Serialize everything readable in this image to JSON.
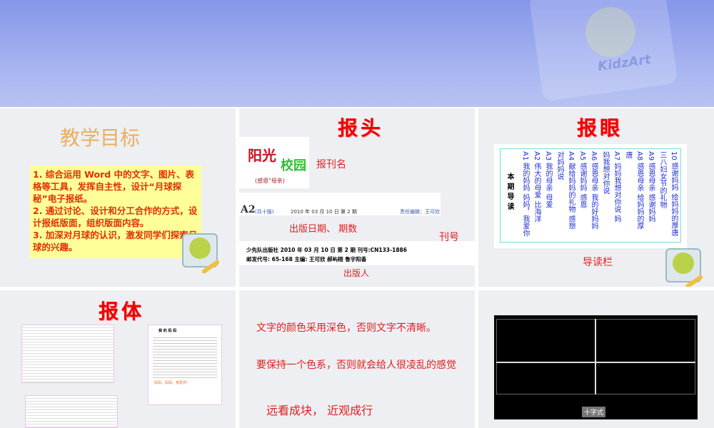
{
  "banner": {
    "brand": "KidzArt"
  },
  "slides": [
    {
      "title": "教学目标",
      "items": [
        "1. 综合运用 Word 中的文字、图片、表格等工具，发挥自主性，设计“月球探秘”电子报纸。",
        "2. 通过讨论、设计和分工合作的方式，设计报纸版面，组织版面内容。",
        "3. 加深对月球的认识，激发同学们探索月球的兴趣。"
      ]
    },
    {
      "title": "报头",
      "masthead_a": "阳光",
      "masthead_b": "校园",
      "masthead_sub": "(感恩\"母亲)",
      "label_name": "报刊名",
      "header_line": {
        "page": "A2",
        "pages": "(共十版)",
        "date": "2010 年 03 月 10 日  第 2 期",
        "editor": "责任编辑：王可欣"
      },
      "label_date": "出版日期、 期数",
      "label_issue": "刊号",
      "footer_line1": "少先队出版社   2010 年 03 月 10 日   第 2 期   刊号:CN133-1886",
      "footer_line2": "邮发代号: 65-168   主编: 王可欣 郝屿栩 鲁宇阳香",
      "label_publisher": "出版人"
    },
    {
      "title": "报眼",
      "columns": [
        "10 感谢妈妈 给妈妈的厚唐",
        "三八妇女节的礼物",
        "A9 感恩母亲 感谢妈妈",
        "A8 感恩母亲 给妈妈的厚",
        "唐",
        "A7 妈妈我想对你说 妈",
        "妈我想对你说",
        "A6 感恩母亲 我的好妈妈",
        "A5 感谢妈妈 感恩",
        "A4 献给妈妈的礼物 感想",
        "对妈妈说",
        "A3 我的母亲 母爱",
        "A2 伟大的母爱 比海洋",
        "A1 我的妈妈 妈妈，我爱你"
      ],
      "heading": "本期导读",
      "label": "导读栏"
    },
    {
      "title": "报体",
      "thumb_title": "我 的 妈 妈",
      "thumb_caption": "妈妈，妈妈，我爱你!"
    },
    {
      "line1": "文字的颜色采用深色，否则文字不清晰。",
      "line2": "要保持一个色系，否则就会给人很凌乱的感觉",
      "line3": "远看成块， 近观成行"
    },
    {
      "caption": "十字式"
    }
  ]
}
